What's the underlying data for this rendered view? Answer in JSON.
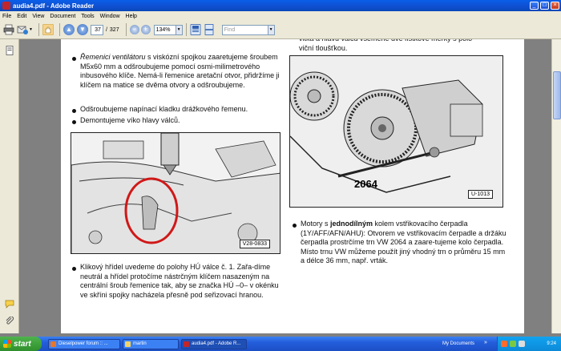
{
  "window": {
    "title": "audia4.pdf - Adobe Reader",
    "controls": [
      "_",
      "□",
      "×"
    ]
  },
  "menu": [
    "File",
    "Edit",
    "View",
    "Document",
    "Tools",
    "Window",
    "Help"
  ],
  "toolbar": {
    "current_page": "37",
    "page_separator": "/",
    "total_pages": "327",
    "zoom": "134%",
    "find_placeholder": "Find"
  },
  "document": {
    "top_right_text": "vitka a hlavu válců všeměné dvě lístkové měrky s polo-\nviční tloušťkou.",
    "bullets_top_left": [
      {
        "html": "<i>Řemenici ventilátoru</i> s viskózní spojkou zaaretujeme šroubem M5x60 mm a odšroubujeme pomocí osmi-milimetrového inbusového klíče. Nemá-li řemenice aretační otvor, přidržíme ji klíčem na matice se dvěma otvory a odšroubujeme."
      },
      {
        "html": "Odšroubujeme napínací kladku drážkového řemenu."
      },
      {
        "html": "Demontujeme víko hlavy válců."
      }
    ],
    "figure_left_label": "V28-0833",
    "figure_right_number": "2064",
    "figure_right_label": "U-1013",
    "bullet_right": "Motory s <b>jednodílným</b> kolem vstřikovacího čerpadla (1Y/AFF/AFN/AHU): Otvorem ve vstřikovacím čerpadle a držáku čerpadla prostrčíme trn VW 2064 a zaare-tujeme kolo čerpadla. Místo trnu VW můžeme použít jiný vhodný trn o průměru 15 mm a délce 36 mm, např. vrták.",
    "bullet_bottom_left": "Klikový hřídel uvedeme do polohy HÚ válce č. 1. Zařa-díme neutrál a hřídel protočíme nástrčným klíčem nasazeným na centrální šroub řemenice tak, aby se značka HÚ –0– v okénku ve skříni spojky nacházela přesně pod seřizovací hranou."
  },
  "taskbar": {
    "start": "start",
    "tasks": [
      {
        "label": "Dieselpower forum :: ...",
        "color": "#e8762b"
      },
      {
        "label": "martin",
        "color": "#f1d36b"
      },
      {
        "label": "audia4.pdf - Adobe R...",
        "color": "#c0262c",
        "active": true
      }
    ],
    "my_documents": "My Documents",
    "clock": "9:24"
  },
  "colors": {
    "titlebar": "#0f4fcf",
    "chrome": "#ece9d8",
    "doc_background": "#808080",
    "highlight_circle": "#d01818"
  }
}
